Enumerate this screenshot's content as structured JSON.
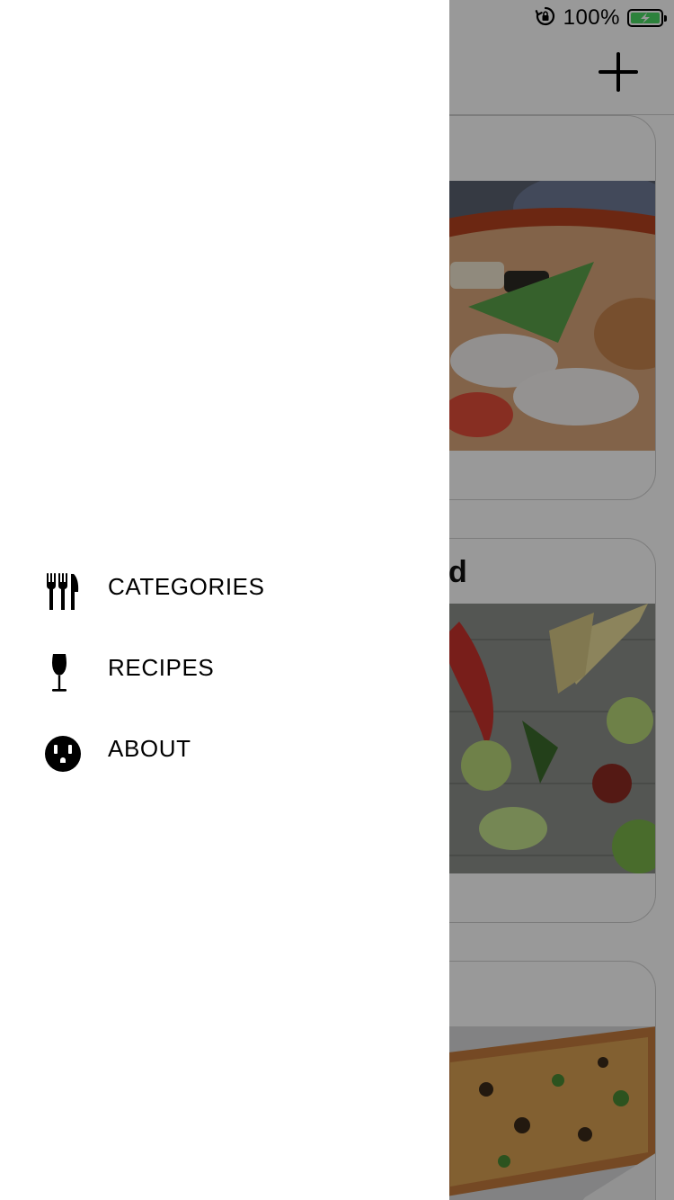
{
  "status_bar": {
    "battery_percent": "100%",
    "battery_level": 1.0,
    "battery_color": "#4cd964",
    "rotation_lock_icon": "rotation-lock-icon"
  },
  "nav_bar": {
    "add_icon": "plus-icon"
  },
  "cards": [
    {
      "title": "",
      "image": "sushi-platter"
    },
    {
      "title": "d",
      "image": "vegetables-corn-peppers-limes"
    },
    {
      "title": "",
      "image": "pizza-with-jalapenos"
    }
  ],
  "drawer": {
    "menu": [
      {
        "label": "CATEGORIES",
        "icon": "utensils-icon"
      },
      {
        "label": "RECIPES",
        "icon": "wine-glass-icon"
      },
      {
        "label": "ABOUT",
        "icon": "power-outlet-icon"
      }
    ]
  },
  "colors": {
    "scrim": "rgba(0,0,0,0.40)",
    "drawer_background": "#ffffff",
    "text": "#000000",
    "divider": "#cfcfcf"
  }
}
